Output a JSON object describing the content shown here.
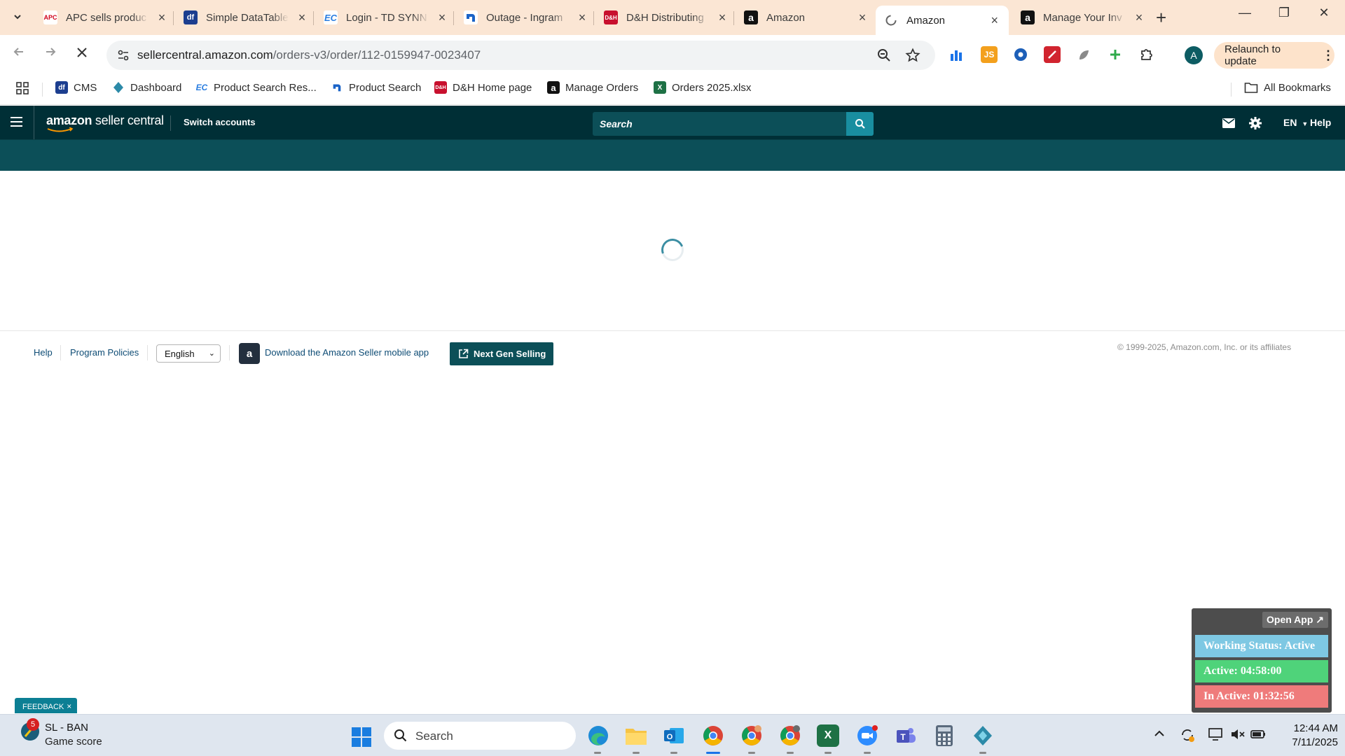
{
  "browser": {
    "tabs": [
      {
        "title": "APC sells produc",
        "favicon": "apc-icon",
        "color": "#d0021b"
      },
      {
        "title": "Simple DataTable",
        "favicon": "df-icon",
        "color": "#1c3e8f"
      },
      {
        "title": "Login - TD SYNN",
        "favicon": "ec-icon",
        "color": "#2a7ee0"
      },
      {
        "title": "Outage - Ingram",
        "favicon": "ingram-icon",
        "color": "#1a63c7"
      },
      {
        "title": "D&H Distributing",
        "favicon": "dh-icon",
        "color": "#c8102e"
      },
      {
        "title": "Amazon",
        "favicon": "amazon-icon",
        "color": "#111111"
      },
      {
        "title": "Amazon",
        "favicon": "loading-icon",
        "color": "#666666",
        "active": true
      },
      {
        "title": "Manage Your Inv",
        "favicon": "amazon-icon",
        "color": "#111111"
      }
    ],
    "url_host": "sellercentral.amazon.com",
    "url_path": "/orders-v3/order/112-0159947-0023407",
    "relaunch_label": "Relaunch to update",
    "profile_initial": "A",
    "bookmarks": [
      {
        "label": "CMS",
        "icon": "df-icon",
        "color": "#1c3e8f"
      },
      {
        "label": "Dashboard",
        "icon": "diamond-icon",
        "color": "#2c8aa8"
      },
      {
        "label": "Product Search Res...",
        "icon": "ec-icon",
        "color": "#2a7ee0"
      },
      {
        "label": "Product Search",
        "icon": "ingram-icon",
        "color": "#1a63c7"
      },
      {
        "label": "D&H Home page",
        "icon": "dh-icon",
        "color": "#c8102e"
      },
      {
        "label": "Manage Orders",
        "icon": "amazon-icon",
        "color": "#111111"
      },
      {
        "label": "Orders 2025.xlsx",
        "icon": "excel-icon",
        "color": "#1e7145"
      }
    ],
    "all_bookmarks_label": "All Bookmarks"
  },
  "seller_central": {
    "logo_amazon": "amazon",
    "logo_rest": " seller central",
    "switch_accounts": "Switch accounts",
    "search_placeholder": "Search",
    "language": "EN",
    "help": "Help"
  },
  "footer": {
    "help": "Help",
    "program_policies": "Program Policies",
    "language_selected": "English",
    "download_app": "Download the Amazon Seller mobile app",
    "next_gen": "Next Gen Selling",
    "copyright": "© 1999-2025, Amazon.com, Inc. or its affiliates"
  },
  "feedback": {
    "label": "FEEDBACK",
    "close": "×"
  },
  "tracker": {
    "open_app": "Open App ↗",
    "working_status": "Working Status: Active",
    "active": "Active: 04:58:00",
    "inactive": "In Active: 01:32:56",
    "colors": {
      "status": "#7ec8e3",
      "active": "#4fd37a",
      "inactive": "#ef7b7b"
    }
  },
  "taskbar": {
    "score_badge": "5",
    "score_title": "SL - BAN",
    "score_subtitle": "Game score",
    "search_label": "Search",
    "time": "12:44 AM",
    "date": "7/11/2025"
  }
}
